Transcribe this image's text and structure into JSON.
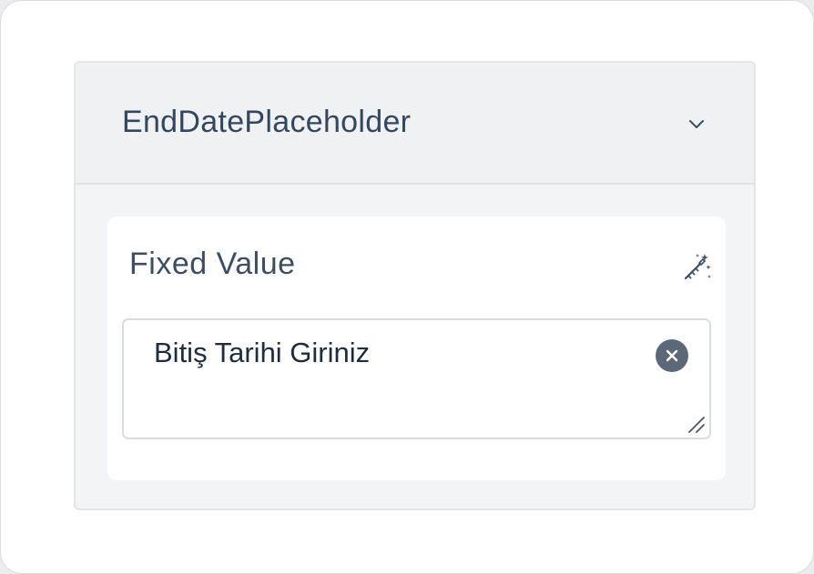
{
  "panel": {
    "title": "EndDatePlaceholder",
    "expand_icon": "chevron-down-icon"
  },
  "field": {
    "label": "Fixed Value",
    "action_icon": "magic-wand-icon",
    "value": "Bitiş Tarihi Giriniz",
    "clear_icon": "close-circle-icon",
    "resize_icon": "resize-handle-icon"
  },
  "colors": {
    "title_text": "#33475f",
    "value_text": "#1f2c3d",
    "header_bg": "#f0f1f3",
    "clear_button_bg": "#5c6778"
  }
}
